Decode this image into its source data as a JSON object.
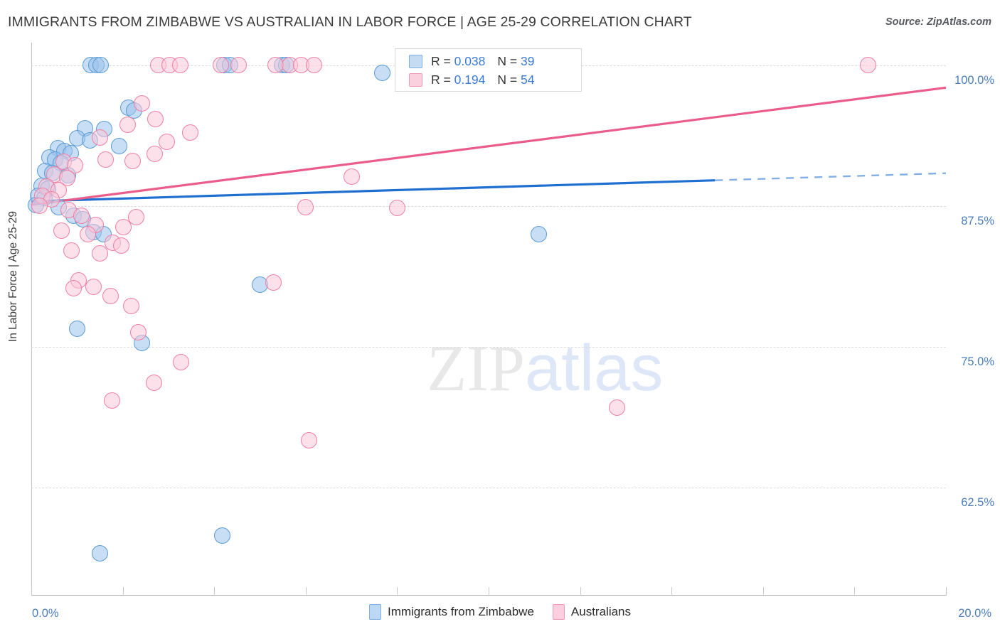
{
  "header": {
    "title": "IMMIGRANTS FROM ZIMBABWE VS AUSTRALIAN IN LABOR FORCE | AGE 25-29 CORRELATION CHART",
    "source": "Source: ZipAtlas.com"
  },
  "watermark": {
    "part1": "ZIP",
    "part2": "atlas"
  },
  "legend": {
    "blue": {
      "r_label": "R = ",
      "r_value": "0.038",
      "n_label": "N = ",
      "n_value": "39"
    },
    "pink": {
      "r_label": "R = ",
      "r_value": "0.194",
      "n_label": "N = ",
      "n_value": "54"
    }
  },
  "series_legend": [
    {
      "name": "series-immigrants-zimbabwe",
      "label": "Immigrants from Zimbabwe",
      "color": "#bcd8f5"
    },
    {
      "name": "series-australians",
      "label": "Australians",
      "color": "#fbcfdd"
    }
  ],
  "chart_data": {
    "type": "scatter",
    "title": "IMMIGRANTS FROM ZIMBABWE VS AUSTRALIAN IN LABOR FORCE | AGE 25-29 CORRELATION CHART",
    "xlabel": "",
    "ylabel": "In Labor Force | Age 25-29",
    "xlim": [
      0.0,
      20.0
    ],
    "ylim": [
      53.0,
      102.0
    ],
    "x_tick_labels": [
      "0.0%",
      "20.0%"
    ],
    "y_tick_labels": [
      "100.0%",
      "87.5%",
      "75.0%",
      "62.5%"
    ],
    "y_ticks": [
      100.0,
      87.5,
      75.0,
      62.5
    ],
    "grid": true,
    "legend_position": "bottom-center",
    "series": [
      {
        "name": "Immigrants from Zimbabwe",
        "color": "#9ac3ed",
        "border": "#5b9bd5",
        "R": 0.038,
        "N": 39,
        "points": [
          [
            1.3,
            100.0
          ],
          [
            1.42,
            100.0
          ],
          [
            1.52,
            100.0
          ],
          [
            4.22,
            100.0
          ],
          [
            4.34,
            100.0
          ],
          [
            5.48,
            100.0
          ],
          [
            5.58,
            100.0
          ],
          [
            7.68,
            99.3
          ],
          [
            2.12,
            96.2
          ],
          [
            2.24,
            96.0
          ],
          [
            1.18,
            94.4
          ],
          [
            1.6,
            94.3
          ],
          [
            1.0,
            93.5
          ],
          [
            1.28,
            93.3
          ],
          [
            1.92,
            92.8
          ],
          [
            0.58,
            92.6
          ],
          [
            0.72,
            92.4
          ],
          [
            0.86,
            92.2
          ],
          [
            0.4,
            91.8
          ],
          [
            0.52,
            91.6
          ],
          [
            0.64,
            91.3
          ],
          [
            0.3,
            90.6
          ],
          [
            0.46,
            90.4
          ],
          [
            0.8,
            90.2
          ],
          [
            0.22,
            89.3
          ],
          [
            0.36,
            89.0
          ],
          [
            0.14,
            88.4
          ],
          [
            0.28,
            88.2
          ],
          [
            0.1,
            87.6
          ],
          [
            0.6,
            87.4
          ],
          [
            0.92,
            86.6
          ],
          [
            1.12,
            86.3
          ],
          [
            1.36,
            85.2
          ],
          [
            1.58,
            85.0
          ],
          [
            11.1,
            85.0
          ],
          [
            5.0,
            80.5
          ],
          [
            1.0,
            76.6
          ],
          [
            2.42,
            75.3
          ],
          [
            4.18,
            58.2
          ],
          [
            1.5,
            56.6
          ]
        ]
      },
      {
        "name": "Australians",
        "color": "#fac8d8",
        "border": "#ef7fa4",
        "R": 0.194,
        "N": 54,
        "points": [
          [
            2.78,
            100.0
          ],
          [
            3.02,
            100.0
          ],
          [
            3.26,
            100.0
          ],
          [
            4.14,
            100.0
          ],
          [
            4.54,
            100.0
          ],
          [
            5.34,
            100.0
          ],
          [
            5.66,
            100.0
          ],
          [
            5.9,
            100.0
          ],
          [
            6.18,
            100.0
          ],
          [
            18.3,
            100.0
          ],
          [
            2.42,
            96.6
          ],
          [
            2.72,
            95.2
          ],
          [
            2.1,
            94.7
          ],
          [
            3.48,
            94.0
          ],
          [
            2.96,
            93.2
          ],
          [
            1.5,
            93.6
          ],
          [
            2.7,
            92.1
          ],
          [
            1.62,
            91.6
          ],
          [
            2.22,
            91.5
          ],
          [
            0.7,
            91.4
          ],
          [
            0.96,
            91.1
          ],
          [
            0.5,
            90.3
          ],
          [
            0.78,
            90.0
          ],
          [
            7.0,
            90.1
          ],
          [
            0.34,
            89.2
          ],
          [
            0.6,
            88.9
          ],
          [
            0.24,
            88.4
          ],
          [
            0.44,
            88.1
          ],
          [
            6.0,
            87.4
          ],
          [
            8.0,
            87.3
          ],
          [
            0.18,
            87.5
          ],
          [
            0.82,
            87.1
          ],
          [
            1.1,
            86.6
          ],
          [
            2.3,
            86.5
          ],
          [
            1.4,
            85.8
          ],
          [
            2.02,
            85.6
          ],
          [
            0.66,
            85.3
          ],
          [
            1.24,
            85.0
          ],
          [
            1.78,
            84.2
          ],
          [
            1.96,
            84.0
          ],
          [
            0.88,
            83.5
          ],
          [
            1.5,
            83.3
          ],
          [
            1.04,
            80.9
          ],
          [
            0.92,
            80.2
          ],
          [
            1.36,
            80.3
          ],
          [
            5.3,
            80.7
          ],
          [
            1.74,
            79.5
          ],
          [
            2.18,
            78.6
          ],
          [
            2.34,
            76.3
          ],
          [
            3.28,
            73.6
          ],
          [
            2.68,
            71.8
          ],
          [
            1.76,
            70.2
          ],
          [
            12.8,
            69.6
          ],
          [
            6.08,
            66.7
          ]
        ]
      }
    ],
    "trendlines": [
      {
        "name": "blue-trendline",
        "color": "#1f6fd0",
        "x0": 0.0,
        "y0": 87.9,
        "x1": 20.0,
        "y1": 90.4,
        "solid_until_x": 14.95
      },
      {
        "name": "pink-trendline",
        "color": "#ea5d8a",
        "x0": 0.0,
        "y0": 87.6,
        "x1": 20.0,
        "y1": 98.0,
        "solid_until_x": 20.0
      }
    ]
  }
}
